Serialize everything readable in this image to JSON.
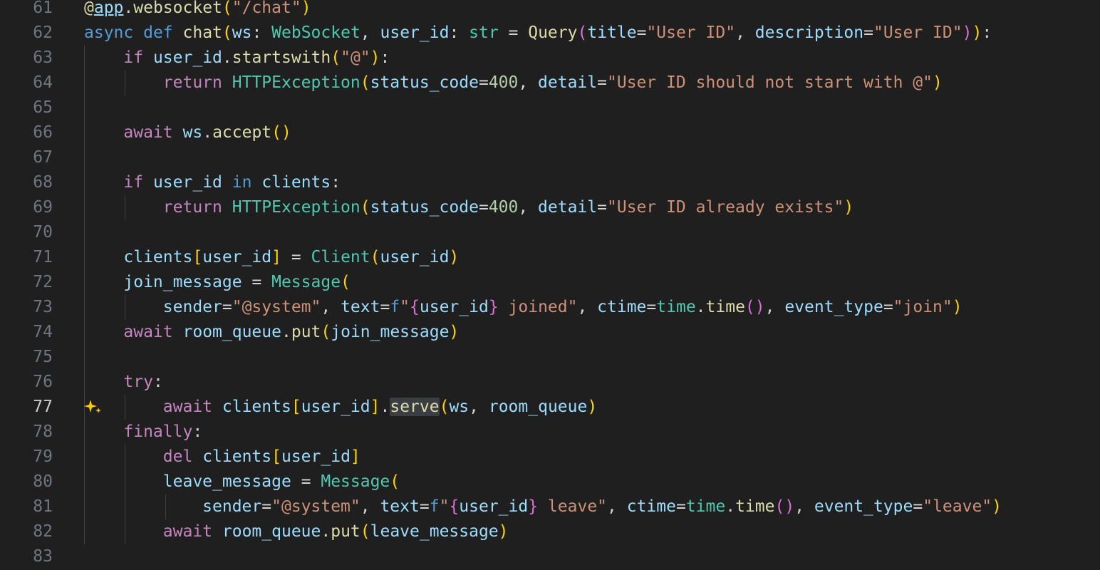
{
  "editor": {
    "line_numbers": [
      "61",
      "62",
      "63",
      "64",
      "65",
      "66",
      "67",
      "68",
      "69",
      "70",
      "71",
      "72",
      "73",
      "74",
      "75",
      "76",
      "77",
      "78",
      "79",
      "80",
      "81",
      "82",
      "83"
    ],
    "active_line": "77",
    "lines": [
      [
        {
          "t": "@",
          "c": "fn"
        },
        {
          "t": "app",
          "c": "vr deco-underline"
        },
        {
          "t": ".",
          "c": "op"
        },
        {
          "t": "websocket",
          "c": "fn"
        },
        {
          "t": "(",
          "c": "b1"
        },
        {
          "t": "\"/chat\"",
          "c": "st"
        },
        {
          "t": ")",
          "c": "b1"
        }
      ],
      [
        {
          "t": "async",
          "c": "kw"
        },
        {
          "t": " ",
          "c": "op"
        },
        {
          "t": "def",
          "c": "kw"
        },
        {
          "t": " ",
          "c": "op"
        },
        {
          "t": "chat",
          "c": "fn"
        },
        {
          "t": "(",
          "c": "b1"
        },
        {
          "t": "ws",
          "c": "vr"
        },
        {
          "t": ": ",
          "c": "op"
        },
        {
          "t": "WebSocket",
          "c": "ty"
        },
        {
          "t": ", ",
          "c": "op"
        },
        {
          "t": "user_id",
          "c": "vr"
        },
        {
          "t": ": ",
          "c": "op"
        },
        {
          "t": "str",
          "c": "ty"
        },
        {
          "t": " = ",
          "c": "op"
        },
        {
          "t": "Query",
          "c": "fn"
        },
        {
          "t": "(",
          "c": "b2"
        },
        {
          "t": "title",
          "c": "vr"
        },
        {
          "t": "=",
          "c": "op"
        },
        {
          "t": "\"User ID\"",
          "c": "st"
        },
        {
          "t": ", ",
          "c": "op"
        },
        {
          "t": "description",
          "c": "vr"
        },
        {
          "t": "=",
          "c": "op"
        },
        {
          "t": "\"User ID\"",
          "c": "st"
        },
        {
          "t": ")",
          "c": "b2"
        },
        {
          "t": ")",
          "c": "b1"
        },
        {
          "t": ":",
          "c": "op"
        }
      ],
      [
        {
          "t": "    ",
          "c": "op"
        },
        {
          "t": "if",
          "c": "ctl"
        },
        {
          "t": " ",
          "c": "op"
        },
        {
          "t": "user_id",
          "c": "vr"
        },
        {
          "t": ".",
          "c": "op"
        },
        {
          "t": "startswith",
          "c": "fn"
        },
        {
          "t": "(",
          "c": "b1"
        },
        {
          "t": "\"@\"",
          "c": "st"
        },
        {
          "t": ")",
          "c": "b1"
        },
        {
          "t": ":",
          "c": "op"
        }
      ],
      [
        {
          "t": "        ",
          "c": "op"
        },
        {
          "t": "return",
          "c": "ctl"
        },
        {
          "t": " ",
          "c": "op"
        },
        {
          "t": "HTTPException",
          "c": "ty"
        },
        {
          "t": "(",
          "c": "b1"
        },
        {
          "t": "status_code",
          "c": "vr"
        },
        {
          "t": "=",
          "c": "op"
        },
        {
          "t": "400",
          "c": "nm"
        },
        {
          "t": ", ",
          "c": "op"
        },
        {
          "t": "detail",
          "c": "vr"
        },
        {
          "t": "=",
          "c": "op"
        },
        {
          "t": "\"User ID should not start with @\"",
          "c": "st"
        },
        {
          "t": ")",
          "c": "b1"
        }
      ],
      [],
      [
        {
          "t": "    ",
          "c": "op"
        },
        {
          "t": "await",
          "c": "ctl"
        },
        {
          "t": " ",
          "c": "op"
        },
        {
          "t": "ws",
          "c": "vr"
        },
        {
          "t": ".",
          "c": "op"
        },
        {
          "t": "accept",
          "c": "fn"
        },
        {
          "t": "()",
          "c": "b1"
        }
      ],
      [],
      [
        {
          "t": "    ",
          "c": "op"
        },
        {
          "t": "if",
          "c": "ctl"
        },
        {
          "t": " ",
          "c": "op"
        },
        {
          "t": "user_id",
          "c": "vr"
        },
        {
          "t": " ",
          "c": "op"
        },
        {
          "t": "in",
          "c": "kw"
        },
        {
          "t": " ",
          "c": "op"
        },
        {
          "t": "clients",
          "c": "vr"
        },
        {
          "t": ":",
          "c": "op"
        }
      ],
      [
        {
          "t": "        ",
          "c": "op"
        },
        {
          "t": "return",
          "c": "ctl"
        },
        {
          "t": " ",
          "c": "op"
        },
        {
          "t": "HTTPException",
          "c": "ty"
        },
        {
          "t": "(",
          "c": "b1"
        },
        {
          "t": "status_code",
          "c": "vr"
        },
        {
          "t": "=",
          "c": "op"
        },
        {
          "t": "400",
          "c": "nm"
        },
        {
          "t": ", ",
          "c": "op"
        },
        {
          "t": "detail",
          "c": "vr"
        },
        {
          "t": "=",
          "c": "op"
        },
        {
          "t": "\"User ID already exists\"",
          "c": "st"
        },
        {
          "t": ")",
          "c": "b1"
        }
      ],
      [],
      [
        {
          "t": "    ",
          "c": "op"
        },
        {
          "t": "clients",
          "c": "vr"
        },
        {
          "t": "[",
          "c": "b1"
        },
        {
          "t": "user_id",
          "c": "vr"
        },
        {
          "t": "]",
          "c": "b1"
        },
        {
          "t": " = ",
          "c": "op"
        },
        {
          "t": "Client",
          "c": "ty"
        },
        {
          "t": "(",
          "c": "b1"
        },
        {
          "t": "user_id",
          "c": "vr"
        },
        {
          "t": ")",
          "c": "b1"
        }
      ],
      [
        {
          "t": "    ",
          "c": "op"
        },
        {
          "t": "join_message",
          "c": "vr"
        },
        {
          "t": " = ",
          "c": "op"
        },
        {
          "t": "Message",
          "c": "ty"
        },
        {
          "t": "(",
          "c": "b1"
        }
      ],
      [
        {
          "t": "        ",
          "c": "op"
        },
        {
          "t": "sender",
          "c": "vr"
        },
        {
          "t": "=",
          "c": "op"
        },
        {
          "t": "\"@system\"",
          "c": "st"
        },
        {
          "t": ", ",
          "c": "op"
        },
        {
          "t": "text",
          "c": "vr"
        },
        {
          "t": "=",
          "c": "op"
        },
        {
          "t": "f",
          "c": "kw"
        },
        {
          "t": "\"",
          "c": "st"
        },
        {
          "t": "{",
          "c": "b2"
        },
        {
          "t": "user_id",
          "c": "vr"
        },
        {
          "t": "}",
          "c": "b2"
        },
        {
          "t": " joined\"",
          "c": "st"
        },
        {
          "t": ", ",
          "c": "op"
        },
        {
          "t": "ctime",
          "c": "vr"
        },
        {
          "t": "=",
          "c": "op"
        },
        {
          "t": "time",
          "c": "ty"
        },
        {
          "t": ".",
          "c": "op"
        },
        {
          "t": "time",
          "c": "fn"
        },
        {
          "t": "()",
          "c": "b2"
        },
        {
          "t": ", ",
          "c": "op"
        },
        {
          "t": "event_type",
          "c": "vr"
        },
        {
          "t": "=",
          "c": "op"
        },
        {
          "t": "\"join\"",
          "c": "st"
        },
        {
          "t": ")",
          "c": "b1"
        }
      ],
      [
        {
          "t": "    ",
          "c": "op"
        },
        {
          "t": "await",
          "c": "ctl"
        },
        {
          "t": " ",
          "c": "op"
        },
        {
          "t": "room_queue",
          "c": "vr"
        },
        {
          "t": ".",
          "c": "op"
        },
        {
          "t": "put",
          "c": "fn"
        },
        {
          "t": "(",
          "c": "b1"
        },
        {
          "t": "join_message",
          "c": "vr"
        },
        {
          "t": ")",
          "c": "b1"
        }
      ],
      [],
      [
        {
          "t": "    ",
          "c": "op"
        },
        {
          "t": "try",
          "c": "ctl"
        },
        {
          "t": ":",
          "c": "op"
        }
      ],
      [
        {
          "t": "        ",
          "c": "op"
        },
        {
          "t": "await",
          "c": "ctl"
        },
        {
          "t": " ",
          "c": "op"
        },
        {
          "t": "clients",
          "c": "vr"
        },
        {
          "t": "[",
          "c": "b1"
        },
        {
          "t": "user_id",
          "c": "vr"
        },
        {
          "t": "]",
          "c": "b1"
        },
        {
          "t": ".",
          "c": "op"
        },
        {
          "t": "serve",
          "c": "fn hl"
        },
        {
          "t": "(",
          "c": "b1"
        },
        {
          "t": "ws",
          "c": "vr"
        },
        {
          "t": ", ",
          "c": "op"
        },
        {
          "t": "room_queue",
          "c": "vr"
        },
        {
          "t": ")",
          "c": "b1"
        }
      ],
      [
        {
          "t": "    ",
          "c": "op"
        },
        {
          "t": "finally",
          "c": "ctl"
        },
        {
          "t": ":",
          "c": "op"
        }
      ],
      [
        {
          "t": "        ",
          "c": "op"
        },
        {
          "t": "del",
          "c": "ctl"
        },
        {
          "t": " ",
          "c": "op"
        },
        {
          "t": "clients",
          "c": "vr"
        },
        {
          "t": "[",
          "c": "b1"
        },
        {
          "t": "user_id",
          "c": "vr"
        },
        {
          "t": "]",
          "c": "b1"
        }
      ],
      [
        {
          "t": "        ",
          "c": "op"
        },
        {
          "t": "leave_message",
          "c": "vr"
        },
        {
          "t": " = ",
          "c": "op"
        },
        {
          "t": "Message",
          "c": "ty"
        },
        {
          "t": "(",
          "c": "b1"
        }
      ],
      [
        {
          "t": "            ",
          "c": "op"
        },
        {
          "t": "sender",
          "c": "vr"
        },
        {
          "t": "=",
          "c": "op"
        },
        {
          "t": "\"@system\"",
          "c": "st"
        },
        {
          "t": ", ",
          "c": "op"
        },
        {
          "t": "text",
          "c": "vr"
        },
        {
          "t": "=",
          "c": "op"
        },
        {
          "t": "f",
          "c": "kw"
        },
        {
          "t": "\"",
          "c": "st"
        },
        {
          "t": "{",
          "c": "b2"
        },
        {
          "t": "user_id",
          "c": "vr"
        },
        {
          "t": "}",
          "c": "b2"
        },
        {
          "t": " leave\"",
          "c": "st"
        },
        {
          "t": ", ",
          "c": "op"
        },
        {
          "t": "ctime",
          "c": "vr"
        },
        {
          "t": "=",
          "c": "op"
        },
        {
          "t": "time",
          "c": "ty"
        },
        {
          "t": ".",
          "c": "op"
        },
        {
          "t": "time",
          "c": "fn"
        },
        {
          "t": "()",
          "c": "b2"
        },
        {
          "t": ", ",
          "c": "op"
        },
        {
          "t": "event_type",
          "c": "vr"
        },
        {
          "t": "=",
          "c": "op"
        },
        {
          "t": "\"leave\"",
          "c": "st"
        },
        {
          "t": ")",
          "c": "b1"
        }
      ],
      [
        {
          "t": "        ",
          "c": "op"
        },
        {
          "t": "await",
          "c": "ctl"
        },
        {
          "t": " ",
          "c": "op"
        },
        {
          "t": "room_queue",
          "c": "vr"
        },
        {
          "t": ".",
          "c": "op"
        },
        {
          "t": "put",
          "c": "fn"
        },
        {
          "t": "(",
          "c": "b1"
        },
        {
          "t": "leave_message",
          "c": "vr"
        },
        {
          "t": ")",
          "c": "b1"
        }
      ],
      []
    ]
  },
  "icons": {
    "inline_chat": "sparkle-icon"
  },
  "theme": {
    "background": "#1f1f1f",
    "line_number": "#6e7681",
    "line_number_active": "#cccccc",
    "sparkle": "#ffcc00"
  }
}
